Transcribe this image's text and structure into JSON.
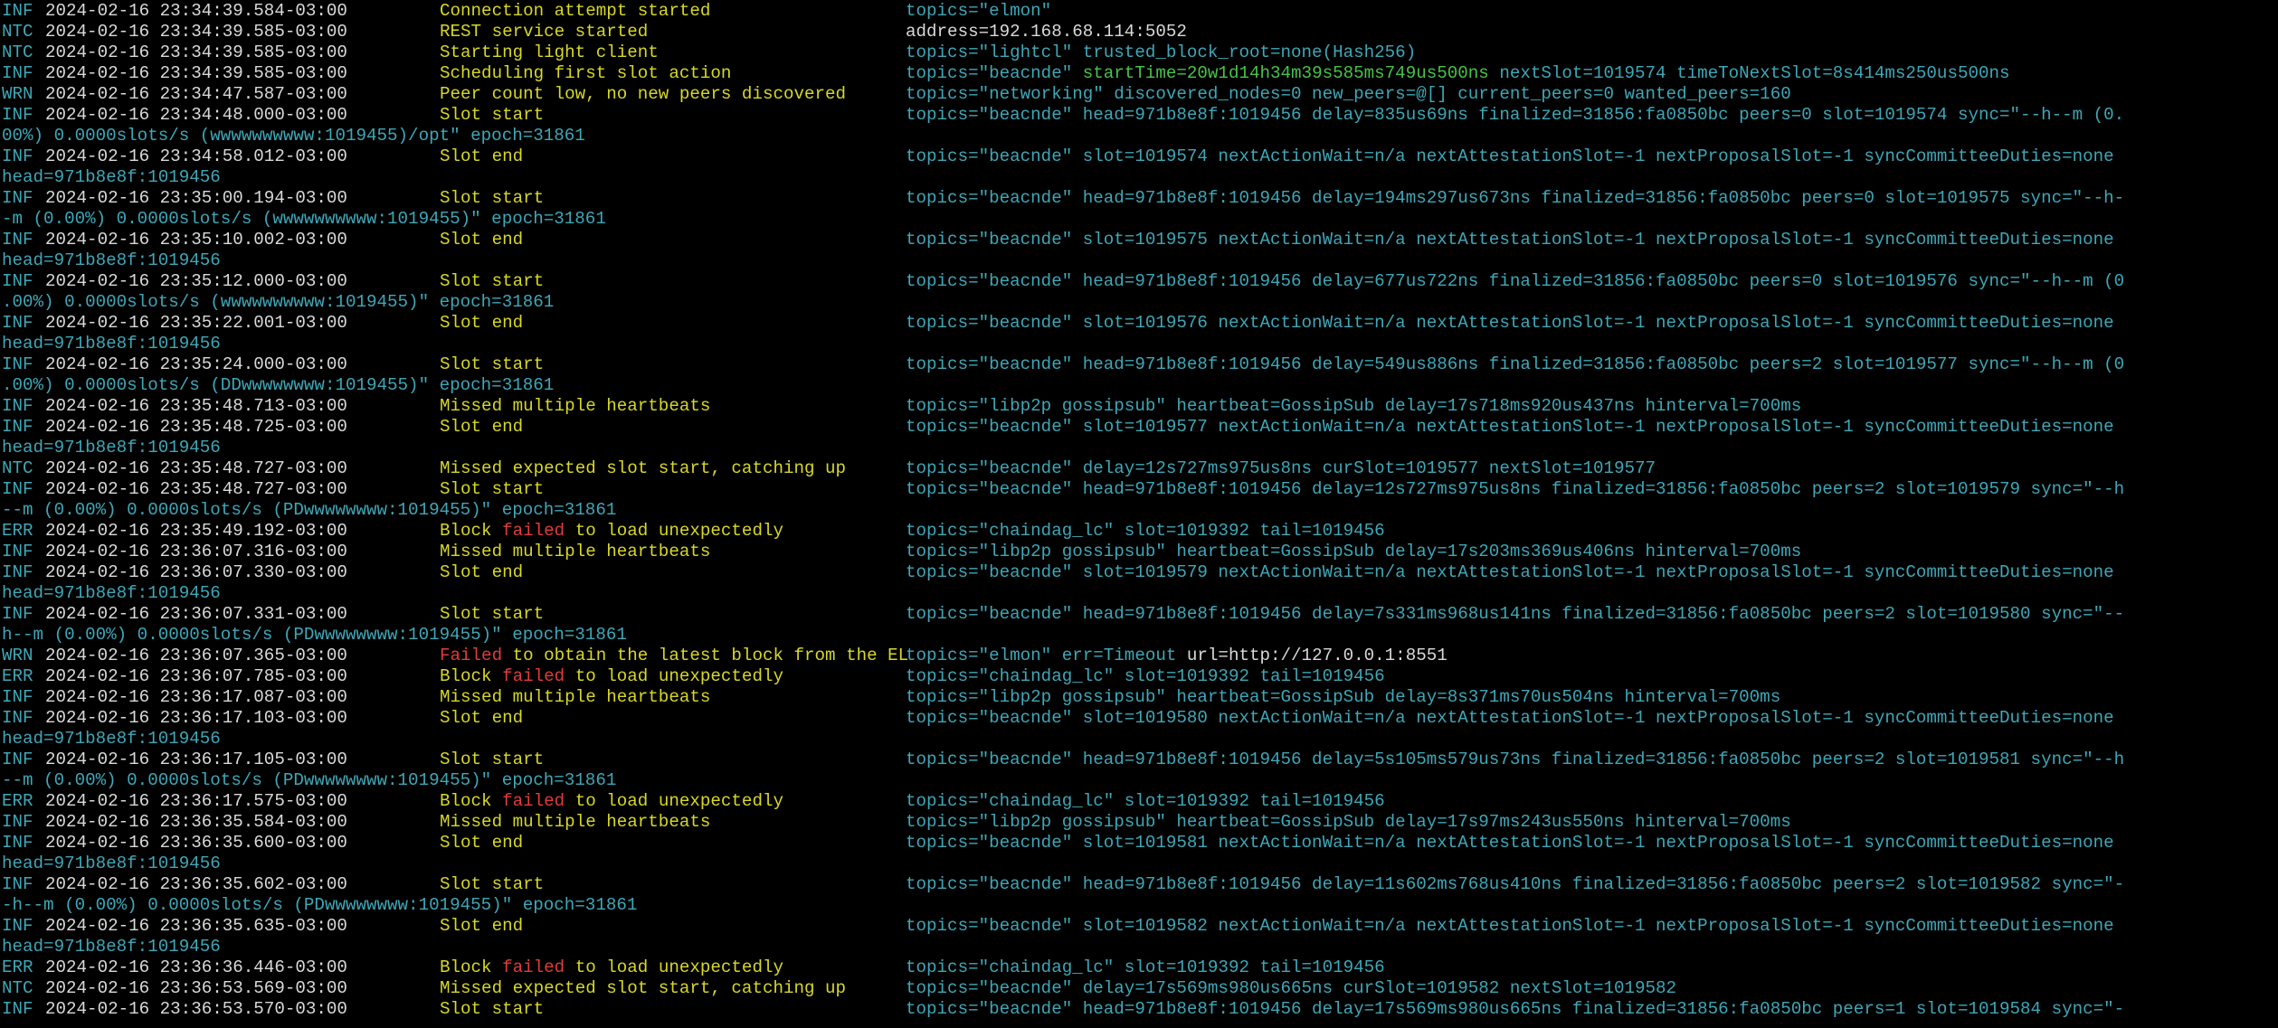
{
  "theme": {
    "background": "#000000",
    "default_text": "#3fa7b7",
    "timestamp": "#d9d9d9",
    "message": "#d7d72a",
    "failed": "#e23b3b",
    "start_time": "#49c24a"
  },
  "lines": [
    {
      "t": "entry",
      "lvl": "INF",
      "ts": "2024-02-16 23:34:39.584-03:00",
      "msg": [
        {
          "x": "Connection attempt started",
          "c": "yellow"
        }
      ],
      "meta": [
        {
          "x": "topics=\"elmon\"",
          "c": "cyan"
        }
      ]
    },
    {
      "t": "entry",
      "lvl": "NTC",
      "ts": "2024-02-16 23:34:39.585-03:00",
      "msg": [
        {
          "x": "REST service started",
          "c": "yellow"
        }
      ],
      "meta": [
        {
          "x": "address=192.168.68.114:5052",
          "c": "white"
        }
      ]
    },
    {
      "t": "entry",
      "lvl": "NTC",
      "ts": "2024-02-16 23:34:39.585-03:00",
      "msg": [
        {
          "x": "Starting light client",
          "c": "yellow"
        }
      ],
      "meta": [
        {
          "x": "topics=\"lightcl\" trusted_block_root=none(Hash256)",
          "c": "cyan"
        }
      ]
    },
    {
      "t": "entry",
      "lvl": "INF",
      "ts": "2024-02-16 23:34:39.585-03:00",
      "msg": [
        {
          "x": "Scheduling first slot action",
          "c": "yellow"
        }
      ],
      "meta": [
        {
          "x": "topics=\"beacnde\" ",
          "c": "cyan"
        },
        {
          "x": "startTime=20w1d14h34m39s585ms749us500ns",
          "c": "green"
        },
        {
          "x": " nextSlot=1019574 timeToNextSlot=8s414ms250us500ns",
          "c": "cyan"
        }
      ]
    },
    {
      "t": "entry",
      "lvl": "WRN",
      "ts": "2024-02-16 23:34:47.587-03:00",
      "msg": [
        {
          "x": "Peer count low, no new peers discovered",
          "c": "yellow"
        }
      ],
      "meta": [
        {
          "x": "topics=\"networking\" discovered_nodes=0 new_peers=@[] current_peers=0 wanted_peers=160",
          "c": "cyan"
        }
      ]
    },
    {
      "t": "entry",
      "lvl": "INF",
      "ts": "2024-02-16 23:34:48.000-03:00",
      "msg": [
        {
          "x": "Slot start",
          "c": "yellow"
        }
      ],
      "meta": [
        {
          "x": "topics=\"beacnde\" head=971b8e8f:1019456 delay=835us69ns finalized=31856:fa0850bc peers=0 slot=1019574 sync=\"--h--m (0.",
          "c": "cyan"
        }
      ]
    },
    {
      "t": "cont",
      "text": "00%) 0.0000slots/s (wwwwwwwwww:1019455)/opt\" epoch=31861"
    },
    {
      "t": "entry",
      "lvl": "INF",
      "ts": "2024-02-16 23:34:58.012-03:00",
      "msg": [
        {
          "x": "Slot end",
          "c": "yellow"
        }
      ],
      "meta": [
        {
          "x": "topics=\"beacnde\" slot=1019574 nextActionWait=n/a nextAttestationSlot=-1 nextProposalSlot=-1 syncCommitteeDuties=none",
          "c": "cyan"
        }
      ]
    },
    {
      "t": "cont",
      "text": "head=971b8e8f:1019456"
    },
    {
      "t": "entry",
      "lvl": "INF",
      "ts": "2024-02-16 23:35:00.194-03:00",
      "msg": [
        {
          "x": "Slot start",
          "c": "yellow"
        }
      ],
      "meta": [
        {
          "x": "topics=\"beacnde\" head=971b8e8f:1019456 delay=194ms297us673ns finalized=31856:fa0850bc peers=0 slot=1019575 sync=\"--h-",
          "c": "cyan"
        }
      ]
    },
    {
      "t": "cont",
      "text": "-m (0.00%) 0.0000slots/s (wwwwwwwwww:1019455)\" epoch=31861"
    },
    {
      "t": "entry",
      "lvl": "INF",
      "ts": "2024-02-16 23:35:10.002-03:00",
      "msg": [
        {
          "x": "Slot end",
          "c": "yellow"
        }
      ],
      "meta": [
        {
          "x": "topics=\"beacnde\" slot=1019575 nextActionWait=n/a nextAttestationSlot=-1 nextProposalSlot=-1 syncCommitteeDuties=none",
          "c": "cyan"
        }
      ]
    },
    {
      "t": "cont",
      "text": "head=971b8e8f:1019456"
    },
    {
      "t": "entry",
      "lvl": "INF",
      "ts": "2024-02-16 23:35:12.000-03:00",
      "msg": [
        {
          "x": "Slot start",
          "c": "yellow"
        }
      ],
      "meta": [
        {
          "x": "topics=\"beacnde\" head=971b8e8f:1019456 delay=677us722ns finalized=31856:fa0850bc peers=0 slot=1019576 sync=\"--h--m (0",
          "c": "cyan"
        }
      ]
    },
    {
      "t": "cont",
      "text": ".00%) 0.0000slots/s (wwwwwwwwww:1019455)\" epoch=31861"
    },
    {
      "t": "entry",
      "lvl": "INF",
      "ts": "2024-02-16 23:35:22.001-03:00",
      "msg": [
        {
          "x": "Slot end",
          "c": "yellow"
        }
      ],
      "meta": [
        {
          "x": "topics=\"beacnde\" slot=1019576 nextActionWait=n/a nextAttestationSlot=-1 nextProposalSlot=-1 syncCommitteeDuties=none",
          "c": "cyan"
        }
      ]
    },
    {
      "t": "cont",
      "text": "head=971b8e8f:1019456"
    },
    {
      "t": "entry",
      "lvl": "INF",
      "ts": "2024-02-16 23:35:24.000-03:00",
      "msg": [
        {
          "x": "Slot start",
          "c": "yellow"
        }
      ],
      "meta": [
        {
          "x": "topics=\"beacnde\" head=971b8e8f:1019456 delay=549us886ns finalized=31856:fa0850bc peers=2 slot=1019577 sync=\"--h--m (0",
          "c": "cyan"
        }
      ]
    },
    {
      "t": "cont",
      "text": ".00%) 0.0000slots/s (DDwwwwwwww:1019455)\" epoch=31861"
    },
    {
      "t": "entry",
      "lvl": "INF",
      "ts": "2024-02-16 23:35:48.713-03:00",
      "msg": [
        {
          "x": "Missed",
          "c": "yellow"
        },
        {
          "x": " multiple heartbeats",
          "c": "yellow"
        }
      ],
      "meta": [
        {
          "x": "topics=\"libp2p gossipsub\" heartbeat=GossipSub delay=17s718ms920us437ns hinterval=700ms",
          "c": "cyan"
        }
      ]
    },
    {
      "t": "entry",
      "lvl": "INF",
      "ts": "2024-02-16 23:35:48.725-03:00",
      "msg": [
        {
          "x": "Slot end",
          "c": "yellow"
        }
      ],
      "meta": [
        {
          "x": "topics=\"beacnde\" slot=1019577 nextActionWait=n/a nextAttestationSlot=-1 nextProposalSlot=-1 syncCommitteeDuties=none",
          "c": "cyan"
        }
      ]
    },
    {
      "t": "cont",
      "text": "head=971b8e8f:1019456"
    },
    {
      "t": "entry",
      "lvl": "NTC",
      "ts": "2024-02-16 23:35:48.727-03:00",
      "msg": [
        {
          "x": "Missed",
          "c": "yellow"
        },
        {
          "x": " expected slot start, catching up",
          "c": "yellow"
        }
      ],
      "meta": [
        {
          "x": "topics=\"beacnde\" delay=12s727ms975us8ns curSlot=1019577 nextSlot=1019577",
          "c": "cyan"
        }
      ]
    },
    {
      "t": "entry",
      "lvl": "INF",
      "ts": "2024-02-16 23:35:48.727-03:00",
      "msg": [
        {
          "x": "Slot start",
          "c": "yellow"
        }
      ],
      "meta": [
        {
          "x": "topics=\"beacnde\" head=971b8e8f:1019456 delay=12s727ms975us8ns finalized=31856:fa0850bc peers=2 slot=1019579 sync=\"--h",
          "c": "cyan"
        }
      ]
    },
    {
      "t": "cont",
      "text": "--m (0.00%) 0.0000slots/s (PDwwwwwwww:1019455)\" epoch=31861"
    },
    {
      "t": "entry",
      "lvl": "ERR",
      "ts": "2024-02-16 23:35:49.192-03:00",
      "msg": [
        {
          "x": "Block ",
          "c": "yellow"
        },
        {
          "x": "failed",
          "c": "red"
        },
        {
          "x": " to load unexpectedly",
          "c": "yellow"
        }
      ],
      "meta": [
        {
          "x": "topics=\"chaindag_lc\" slot=1019392 tail=1019456",
          "c": "cyan"
        }
      ]
    },
    {
      "t": "entry",
      "lvl": "INF",
      "ts": "2024-02-16 23:36:07.316-03:00",
      "msg": [
        {
          "x": "Missed",
          "c": "yellow"
        },
        {
          "x": " multiple heartbeats",
          "c": "yellow"
        }
      ],
      "meta": [
        {
          "x": "topics=\"libp2p gossipsub\" heartbeat=GossipSub delay=17s203ms369us406ns hinterval=700ms",
          "c": "cyan"
        }
      ]
    },
    {
      "t": "entry",
      "lvl": "INF",
      "ts": "2024-02-16 23:36:07.330-03:00",
      "msg": [
        {
          "x": "Slot end",
          "c": "yellow"
        }
      ],
      "meta": [
        {
          "x": "topics=\"beacnde\" slot=1019579 nextActionWait=n/a nextAttestationSlot=-1 nextProposalSlot=-1 syncCommitteeDuties=none",
          "c": "cyan"
        }
      ]
    },
    {
      "t": "cont",
      "text": "head=971b8e8f:1019456"
    },
    {
      "t": "entry",
      "lvl": "INF",
      "ts": "2024-02-16 23:36:07.331-03:00",
      "msg": [
        {
          "x": "Slot start",
          "c": "yellow"
        }
      ],
      "meta": [
        {
          "x": "topics=\"beacnde\" head=971b8e8f:1019456 delay=7s331ms968us141ns finalized=31856:fa0850bc peers=2 slot=1019580 sync=\"--",
          "c": "cyan"
        }
      ]
    },
    {
      "t": "cont",
      "text": "h--m (0.00%) 0.0000slots/s (PDwwwwwwww:1019455)\" epoch=31861"
    },
    {
      "t": "entry",
      "lvl": "WRN",
      "ts": "2024-02-16 23:36:07.365-03:00",
      "msg": [
        {
          "x": "Failed",
          "c": "red"
        },
        {
          "x": " to obtain the latest block from the EL",
          "c": "yellow"
        }
      ],
      "meta": [
        {
          "x": "topics=\"elmon\" err=Timeout ",
          "c": "cyan"
        },
        {
          "x": "url=http://127.0.0.1:8551",
          "c": "white"
        }
      ]
    },
    {
      "t": "entry",
      "lvl": "ERR",
      "ts": "2024-02-16 23:36:07.785-03:00",
      "msg": [
        {
          "x": "Block ",
          "c": "yellow"
        },
        {
          "x": "failed",
          "c": "red"
        },
        {
          "x": " to load unexpectedly",
          "c": "yellow"
        }
      ],
      "meta": [
        {
          "x": "topics=\"chaindag_lc\" slot=1019392 tail=1019456",
          "c": "cyan"
        }
      ]
    },
    {
      "t": "entry",
      "lvl": "INF",
      "ts": "2024-02-16 23:36:17.087-03:00",
      "msg": [
        {
          "x": "Missed",
          "c": "yellow"
        },
        {
          "x": " multiple heartbeats",
          "c": "yellow"
        }
      ],
      "meta": [
        {
          "x": "topics=\"libp2p gossipsub\" heartbeat=GossipSub delay=8s371ms70us504ns hinterval=700ms",
          "c": "cyan"
        }
      ]
    },
    {
      "t": "entry",
      "lvl": "INF",
      "ts": "2024-02-16 23:36:17.103-03:00",
      "msg": [
        {
          "x": "Slot end",
          "c": "yellow"
        }
      ],
      "meta": [
        {
          "x": "topics=\"beacnde\" slot=1019580 nextActionWait=n/a nextAttestationSlot=-1 nextProposalSlot=-1 syncCommitteeDuties=none",
          "c": "cyan"
        }
      ]
    },
    {
      "t": "cont",
      "text": "head=971b8e8f:1019456"
    },
    {
      "t": "entry",
      "lvl": "INF",
      "ts": "2024-02-16 23:36:17.105-03:00",
      "msg": [
        {
          "x": "Slot start",
          "c": "yellow"
        }
      ],
      "meta": [
        {
          "x": "topics=\"beacnde\" head=971b8e8f:1019456 delay=5s105ms579us73ns finalized=31856:fa0850bc peers=2 slot=1019581 sync=\"--h",
          "c": "cyan"
        }
      ]
    },
    {
      "t": "cont",
      "text": "--m (0.00%) 0.0000slots/s (PDwwwwwwww:1019455)\" epoch=31861"
    },
    {
      "t": "entry",
      "lvl": "ERR",
      "ts": "2024-02-16 23:36:17.575-03:00",
      "msg": [
        {
          "x": "Block ",
          "c": "yellow"
        },
        {
          "x": "failed",
          "c": "red"
        },
        {
          "x": " to load unexpectedly",
          "c": "yellow"
        }
      ],
      "meta": [
        {
          "x": "topics=\"chaindag_lc\" slot=1019392 tail=1019456",
          "c": "cyan"
        }
      ]
    },
    {
      "t": "entry",
      "lvl": "INF",
      "ts": "2024-02-16 23:36:35.584-03:00",
      "msg": [
        {
          "x": "Missed",
          "c": "yellow"
        },
        {
          "x": " multiple heartbeats",
          "c": "yellow"
        }
      ],
      "meta": [
        {
          "x": "topics=\"libp2p gossipsub\" heartbeat=GossipSub delay=17s97ms243us550ns hinterval=700ms",
          "c": "cyan"
        }
      ]
    },
    {
      "t": "entry",
      "lvl": "INF",
      "ts": "2024-02-16 23:36:35.600-03:00",
      "msg": [
        {
          "x": "Slot end",
          "c": "yellow"
        }
      ],
      "meta": [
        {
          "x": "topics=\"beacnde\" slot=1019581 nextActionWait=n/a nextAttestationSlot=-1 nextProposalSlot=-1 syncCommitteeDuties=none",
          "c": "cyan"
        }
      ]
    },
    {
      "t": "cont",
      "text": "head=971b8e8f:1019456"
    },
    {
      "t": "entry",
      "lvl": "INF",
      "ts": "2024-02-16 23:36:35.602-03:00",
      "msg": [
        {
          "x": "Slot start",
          "c": "yellow"
        }
      ],
      "meta": [
        {
          "x": "topics=\"beacnde\" head=971b8e8f:1019456 delay=11s602ms768us410ns finalized=31856:fa0850bc peers=2 slot=1019582 sync=\"-",
          "c": "cyan"
        }
      ]
    },
    {
      "t": "cont",
      "text": "-h--m (0.00%) 0.0000slots/s (PDwwwwwwww:1019455)\" epoch=31861"
    },
    {
      "t": "entry",
      "lvl": "INF",
      "ts": "2024-02-16 23:36:35.635-03:00",
      "msg": [
        {
          "x": "Slot end",
          "c": "yellow"
        }
      ],
      "meta": [
        {
          "x": "topics=\"beacnde\" slot=1019582 nextActionWait=n/a nextAttestationSlot=-1 nextProposalSlot=-1 syncCommitteeDuties=none",
          "c": "cyan"
        }
      ]
    },
    {
      "t": "cont",
      "text": "head=971b8e8f:1019456"
    },
    {
      "t": "entry",
      "lvl": "ERR",
      "ts": "2024-02-16 23:36:36.446-03:00",
      "msg": [
        {
          "x": "Block ",
          "c": "yellow"
        },
        {
          "x": "failed",
          "c": "red"
        },
        {
          "x": " to load unexpectedly",
          "c": "yellow"
        }
      ],
      "meta": [
        {
          "x": "topics=\"chaindag_lc\" slot=1019392 tail=1019456",
          "c": "cyan"
        }
      ]
    },
    {
      "t": "entry",
      "lvl": "NTC",
      "ts": "2024-02-16 23:36:53.569-03:00",
      "msg": [
        {
          "x": "Missed",
          "c": "yellow"
        },
        {
          "x": " expected slot start, catching up",
          "c": "yellow"
        }
      ],
      "meta": [
        {
          "x": "topics=\"beacnde\" delay=17s569ms980us665ns curSlot=1019582 nextSlot=1019582",
          "c": "cyan"
        }
      ]
    },
    {
      "t": "entry",
      "lvl": "INF",
      "ts": "2024-02-16 23:36:53.570-03:00",
      "msg": [
        {
          "x": "Slot start",
          "c": "yellow"
        }
      ],
      "meta": [
        {
          "x": "topics=\"beacnde\" head=971b8e8f:1019456 delay=17s569ms980us665ns finalized=31856:fa0850bc peers=1 slot=1019584 sync=\"-",
          "c": "cyan"
        }
      ]
    }
  ]
}
